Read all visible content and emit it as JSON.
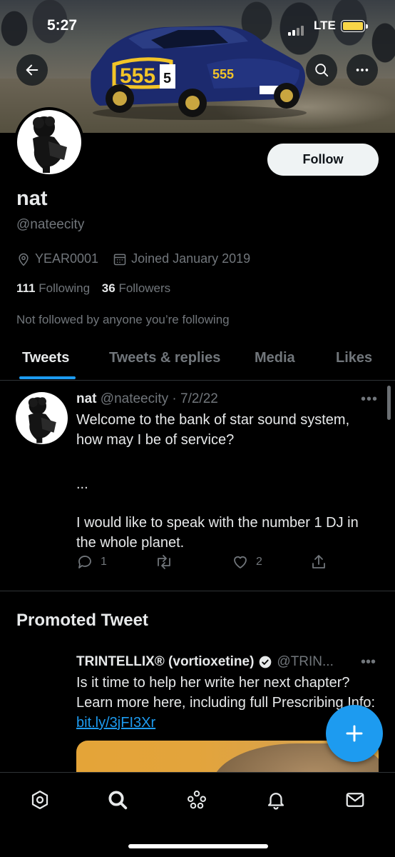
{
  "status_bar": {
    "time": "5:27",
    "network": "LTE",
    "battery_color": "#f8d648"
  },
  "header": {
    "back_icon": "arrow-left-icon",
    "search_icon": "search-icon",
    "more_icon": "more-horizontal-icon"
  },
  "profile": {
    "name": "nat",
    "handle": "@nateecity",
    "location": "YEAR0001",
    "joined": "Joined January 2019",
    "following_count": "111",
    "following_label": "Following",
    "followers_count": "36",
    "followers_label": "Followers",
    "not_followed_text": "Not followed by anyone you’re following",
    "follow_label": "Follow"
  },
  "tabs": [
    {
      "label": "Tweets",
      "active": true
    },
    {
      "label": "Tweets & replies",
      "active": false
    },
    {
      "label": "Media",
      "active": false
    },
    {
      "label": "Likes",
      "active": false
    }
  ],
  "tweet": {
    "author": "nat",
    "handle": "@nateecity",
    "date": "· 7/2/22",
    "more": "•••",
    "line1": "Welcome to the bank of star sound system, how may I be of service?",
    "ellipsis": "...",
    "line2": "I would like to speak with the number 1 DJ in the whole planet.",
    "reply_count": "1",
    "like_count": "2"
  },
  "promoted": {
    "section_title": "Promoted Tweet",
    "author": "TRINTELLIX® (vortioxetine)",
    "handle": "@TRIN...",
    "more": "•••",
    "text": "Is it time to help her write her next chapter? Learn more here, including full Prescribing Info: ",
    "link": "bit.ly/3jFI3Xr"
  },
  "colors": {
    "accent": "#1d9bf0",
    "muted": "#71767b",
    "text": "#e7e9ea"
  },
  "bottom_nav": [
    "home-icon",
    "search-icon",
    "spaces-icon",
    "notifications-icon",
    "messages-icon"
  ]
}
